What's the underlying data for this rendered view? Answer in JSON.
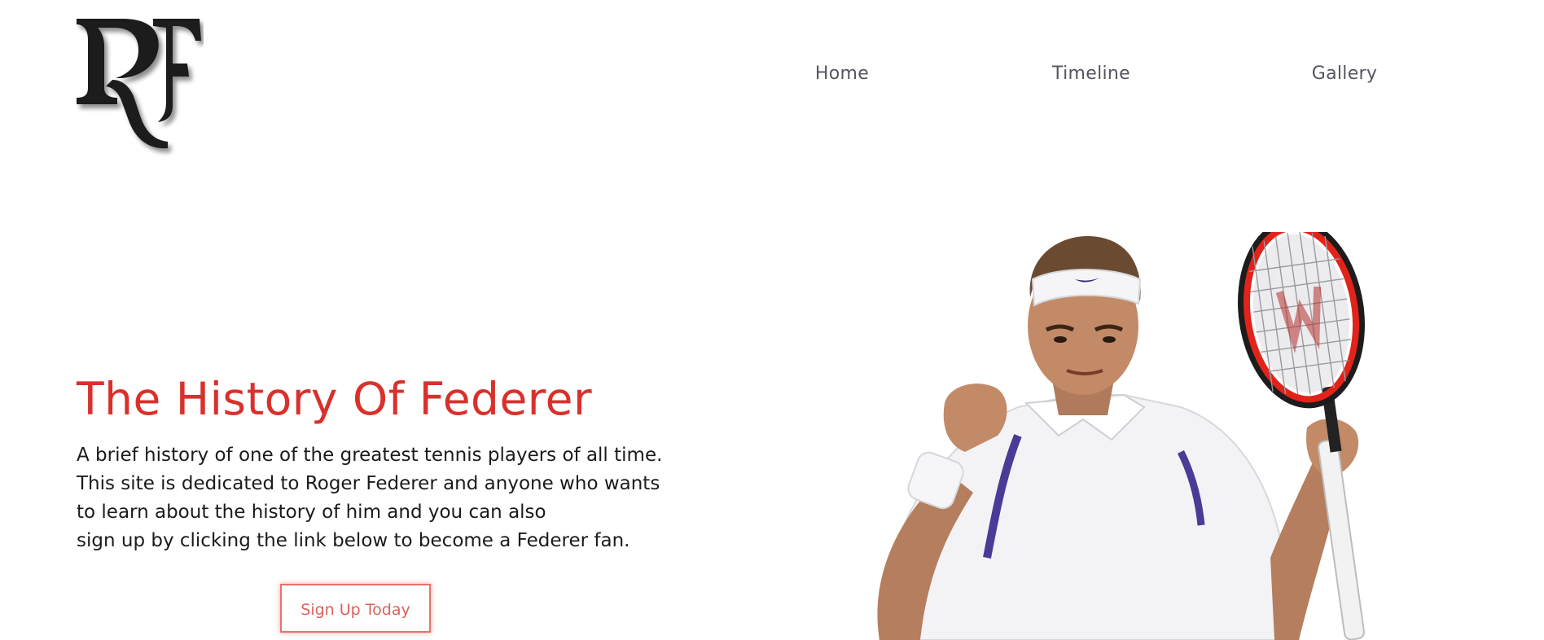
{
  "header": {
    "logo_icon": "rf-monogram-logo",
    "nav": [
      {
        "label": "Home"
      },
      {
        "label": "Timeline"
      },
      {
        "label": "Gallery"
      }
    ]
  },
  "hero": {
    "title": "The History Of Federer",
    "description_lines": [
      "A brief history of one of the greatest tennis players of all time.",
      "This site is dedicated to Roger Federer and anyone who wants",
      "to learn about the history of him and you can also",
      "sign up by clicking the link below to become a Federer fan."
    ],
    "cta_label": "Sign Up Today",
    "image_subject": "tennis-player-with-racket"
  },
  "colors": {
    "accent": "#d9302c",
    "nav_text": "#555560",
    "body_text": "#1b1b1b",
    "button_border": "#e8736c"
  }
}
